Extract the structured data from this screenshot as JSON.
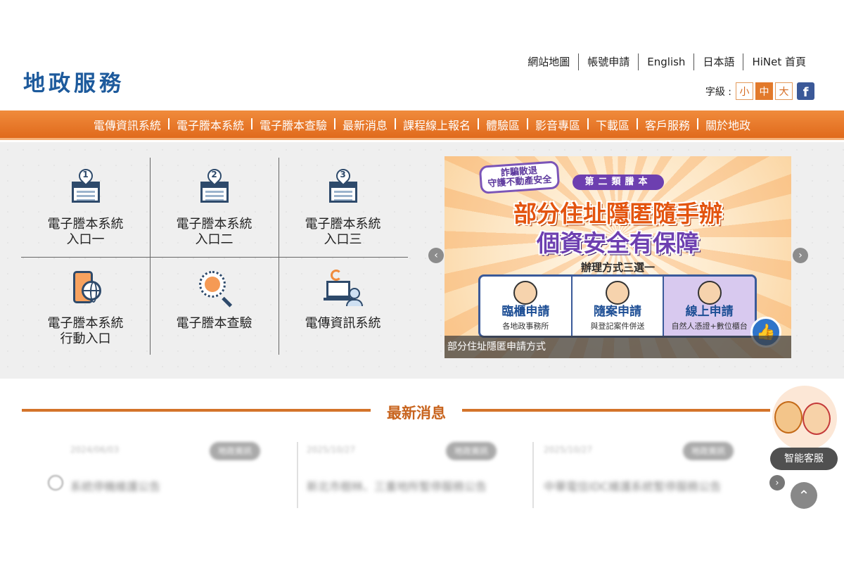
{
  "header": {
    "logo": "地政服務",
    "top_links": [
      "網站地圖",
      "帳號申請",
      "English",
      "日本語",
      "HiNet 首頁"
    ],
    "font_size_label": "字級 :",
    "font_sizes": [
      "小",
      "中",
      "大"
    ],
    "font_size_selected": "中",
    "facebook_icon": "f"
  },
  "nav": {
    "items": [
      "電傳資訊系統",
      "電子謄本系統",
      "電子謄本查驗",
      "最新消息",
      "課程線上報名",
      "體驗區",
      "影音專區",
      "下載區",
      "客戶服務",
      "關於地政"
    ]
  },
  "quick_links": [
    {
      "label": "電子謄本系統\n入口一",
      "line1": "電子謄本系統",
      "line2": "入口一",
      "icon": "window-pin-1-icon",
      "num": "1"
    },
    {
      "label": "電子謄本系統\n入口二",
      "line1": "電子謄本系統",
      "line2": "入口二",
      "icon": "window-pin-2-icon",
      "num": "2"
    },
    {
      "label": "電子謄本系統\n入口三",
      "line1": "電子謄本系統",
      "line2": "入口三",
      "icon": "window-pin-3-icon",
      "num": "3"
    },
    {
      "label": "電子謄本系統\n行動入口",
      "line1": "電子謄本系統",
      "line2": "行動入口",
      "icon": "mobile-globe-icon"
    },
    {
      "label": "電子謄本查驗",
      "line1": "電子謄本查驗",
      "line2": "",
      "icon": "magnifier-person-icon"
    },
    {
      "label": "電傳資訊系統",
      "line1": "電傳資訊系統",
      "line2": "",
      "icon": "laptop-user-icon"
    }
  ],
  "banner": {
    "tag_line1": "詐騙散退",
    "tag_line2": "守護不動產安全",
    "badge": "第二類謄本",
    "headline1": "部分住址隱匿隨手辦",
    "headline2": "個資安全有保障",
    "subtitle": "辦理方式三選一",
    "options": [
      {
        "title": "臨櫃申請",
        "desc": "各地政事務所"
      },
      {
        "title": "隨案申請",
        "desc": "與登記案件併送"
      },
      {
        "title": "線上申請",
        "desc": "自然人憑證+數位櫃台"
      }
    ],
    "like_icon": "👍",
    "caption": "部分住址隱匿申請方式",
    "prev": "‹",
    "next": "›"
  },
  "news": {
    "title": "最新消息",
    "items": [
      {
        "date": "2024/06/03",
        "category": "地政資訊",
        "text": "系統停機維護公告"
      },
      {
        "date": "2025/10/27",
        "category": "地政資訊",
        "text": "新北市樹林、三重地所暫停服務公告"
      },
      {
        "date": "2025/10/27",
        "category": "地政資訊",
        "text": "中華電信IDC維護系統暫停服務公告"
      }
    ],
    "next": "›"
  },
  "chatbot": {
    "label": "智能客服"
  },
  "to_top": "⌃"
}
